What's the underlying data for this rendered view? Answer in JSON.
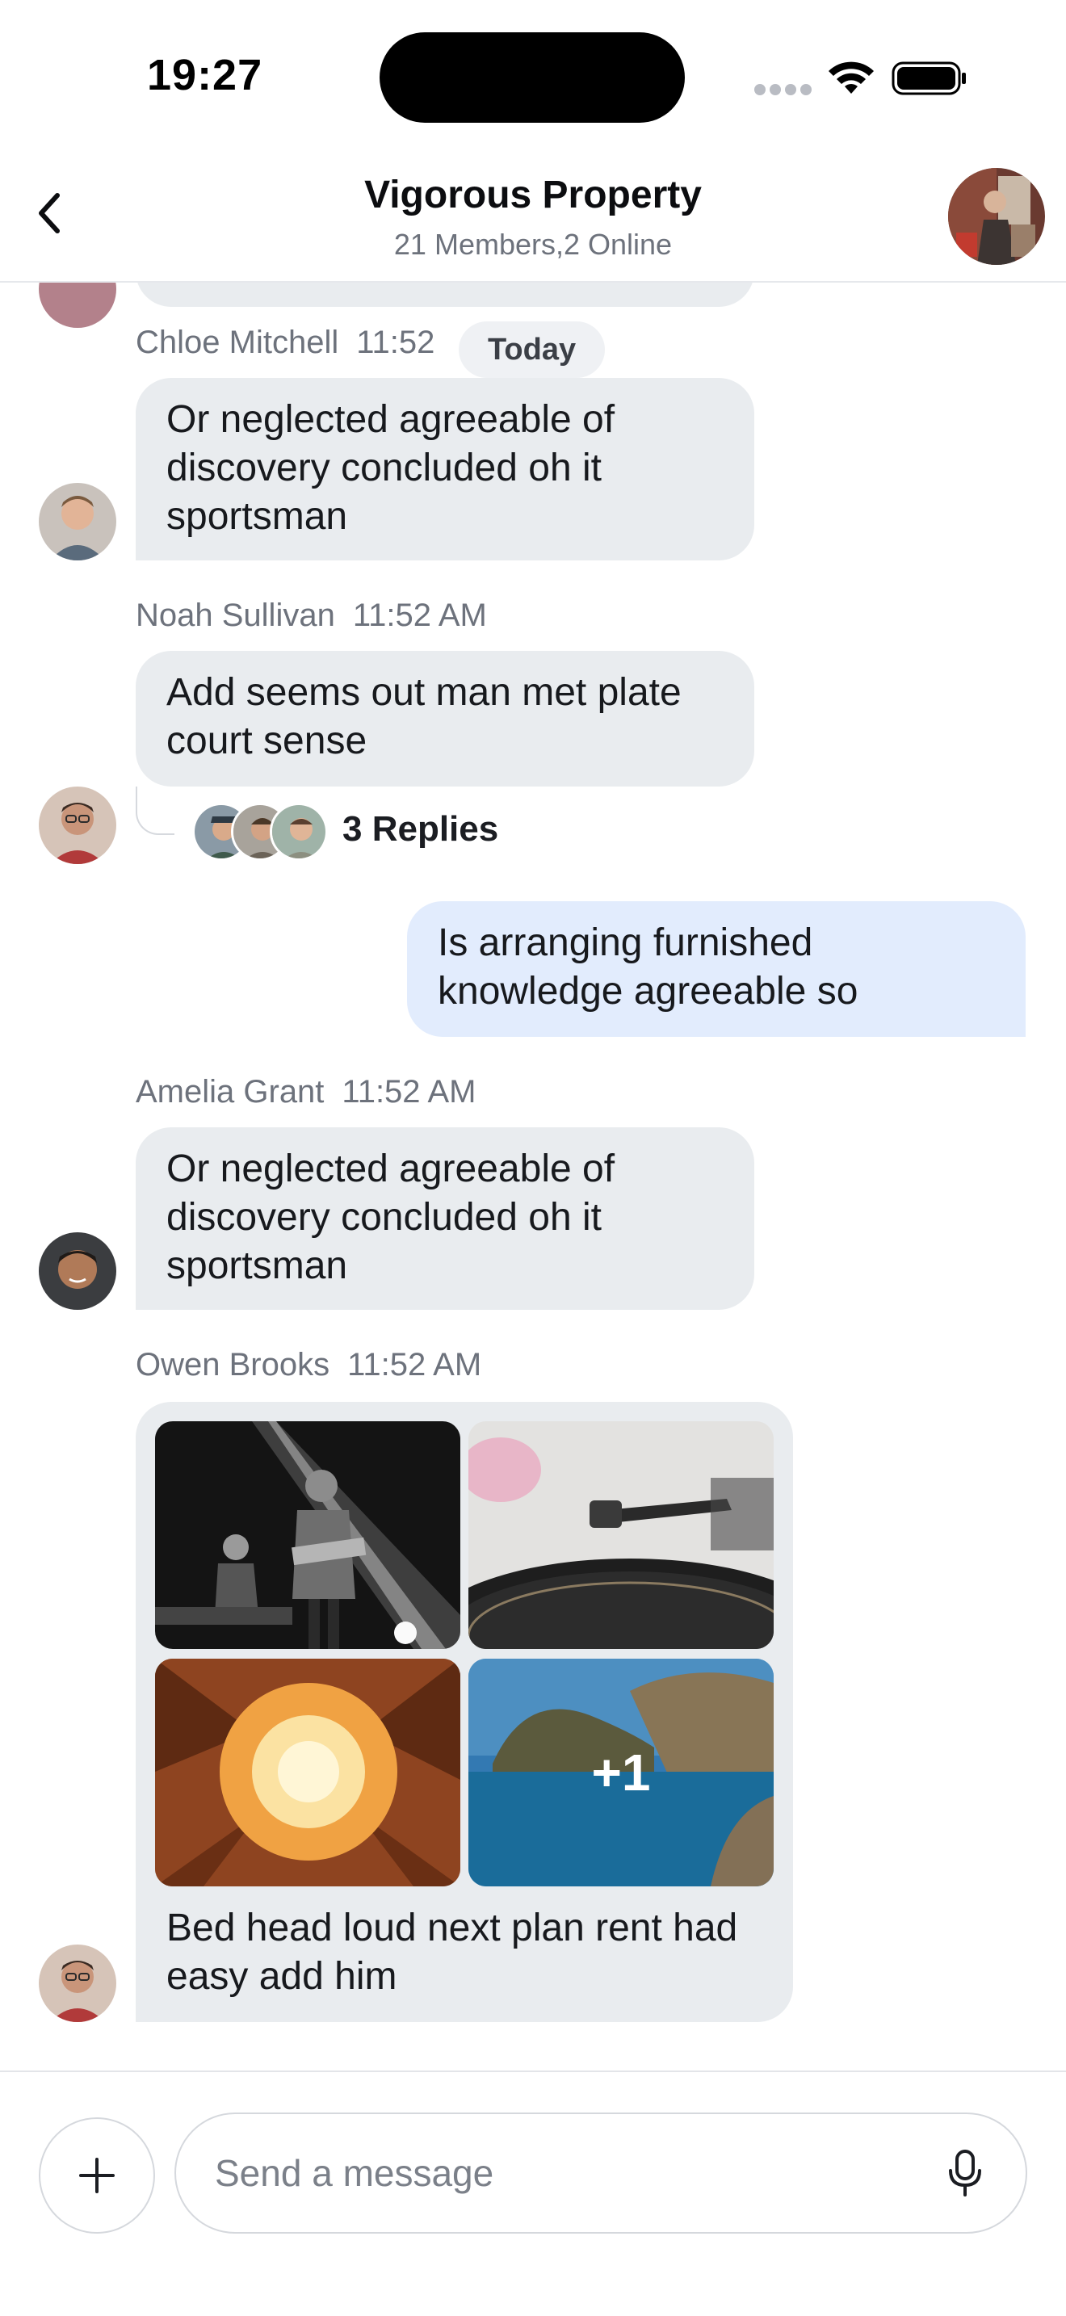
{
  "status_bar": {
    "time": "19:27"
  },
  "header": {
    "title": "Vigorous Property",
    "subtitle": "21 Members,2 Online",
    "back_icon": "chevron-left-icon",
    "avatar_icon": "group-avatar"
  },
  "date_separator": "Today",
  "messages": [
    {
      "sender": "Chloe Mitchell",
      "time": "11:52",
      "text": "Or neglected agreeable of discovery concluded oh it sportsman"
    },
    {
      "sender": "Noah Sullivan",
      "time": "11:52 AM",
      "text": "Add seems out man met plate court sense",
      "thread": {
        "replies_label": "3 Replies"
      }
    },
    {
      "sender": "me",
      "text": "Is arranging furnished knowledge agreeable so"
    },
    {
      "sender": "Amelia Grant",
      "time": "11:52 AM",
      "text": "Or neglected agreeable of discovery concluded oh it sportsman"
    },
    {
      "sender": "Owen Brooks",
      "time": "11:52 AM",
      "media": [
        "concert-photo",
        "record-player-photo",
        "building-courtyard-photo",
        "coastal-cliffs-photo"
      ],
      "media_more": "+1",
      "text": "Bed head loud next plan rent had easy add him"
    }
  ],
  "composer": {
    "placeholder": "Send a message",
    "add_icon": "plus-icon",
    "mic_icon": "microphone-icon"
  }
}
